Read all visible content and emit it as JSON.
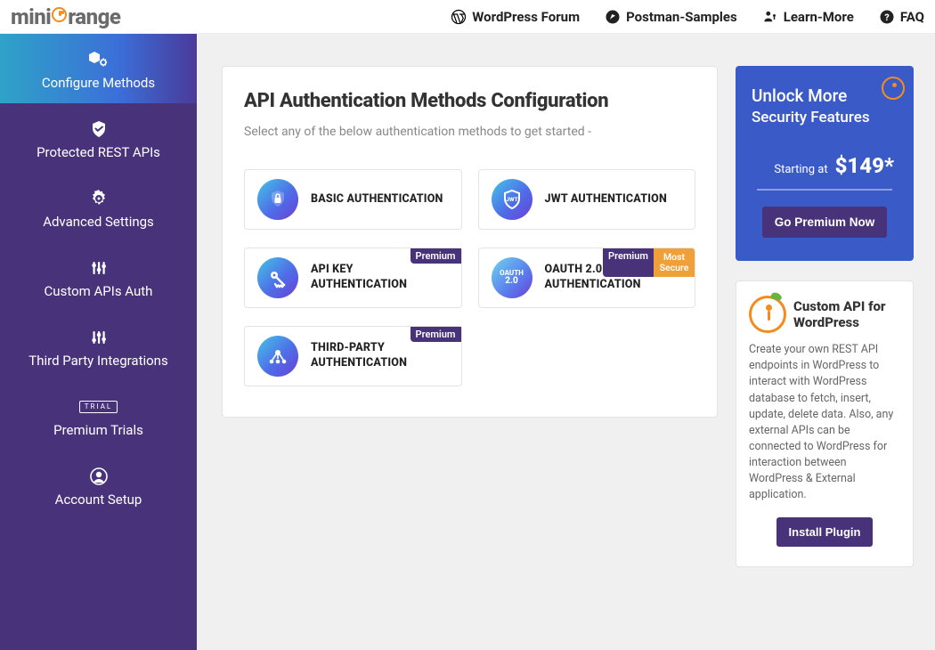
{
  "logo": {
    "left": "mini",
    "right": "range"
  },
  "topnav": {
    "wp": "WordPress Forum",
    "postman": "Postman-Samples",
    "learn": "Learn-More",
    "faq": "FAQ"
  },
  "sidebar": {
    "items": [
      {
        "label": "Configure Methods"
      },
      {
        "label": "Protected REST APIs"
      },
      {
        "label": "Advanced Settings"
      },
      {
        "label": "Custom APIs Auth"
      },
      {
        "label": "Third Party Integrations"
      },
      {
        "label": "Premium Trials",
        "trial_badge": "TRIAL"
      },
      {
        "label": "Account Setup"
      }
    ]
  },
  "panel": {
    "title": "API Authentication Methods Configuration",
    "subtitle": "Select any of the below authentication methods to get started -",
    "cards": [
      {
        "label": "BASIC AUTHENTICATION"
      },
      {
        "label": "JWT AUTHENTICATION"
      },
      {
        "label": "API KEY AUTHENTICATION",
        "premium": "Premium"
      },
      {
        "label": "OAUTH 2.0 AUTHENTICATION",
        "premium": "Premium",
        "secure": "Most Secure",
        "oauth_big": "OAUTH",
        "oauth_small": "2.0"
      },
      {
        "label": "THIRD-PARTY AUTHENTICATION",
        "premium": "Premium"
      }
    ]
  },
  "promo": {
    "line1": "Unlock More",
    "line2": "Security Features",
    "starting": "Starting at",
    "price": "$149*",
    "button": "Go Premium Now"
  },
  "promo2": {
    "title": "Custom API for WordPress",
    "body": "Create your own REST API endpoints in WordPress to interact with WordPress database to fetch, insert, update, delete data. Also, any external APIs can be connected to WordPress for interaction between WordPress & External application.",
    "button": "Install Plugin"
  }
}
